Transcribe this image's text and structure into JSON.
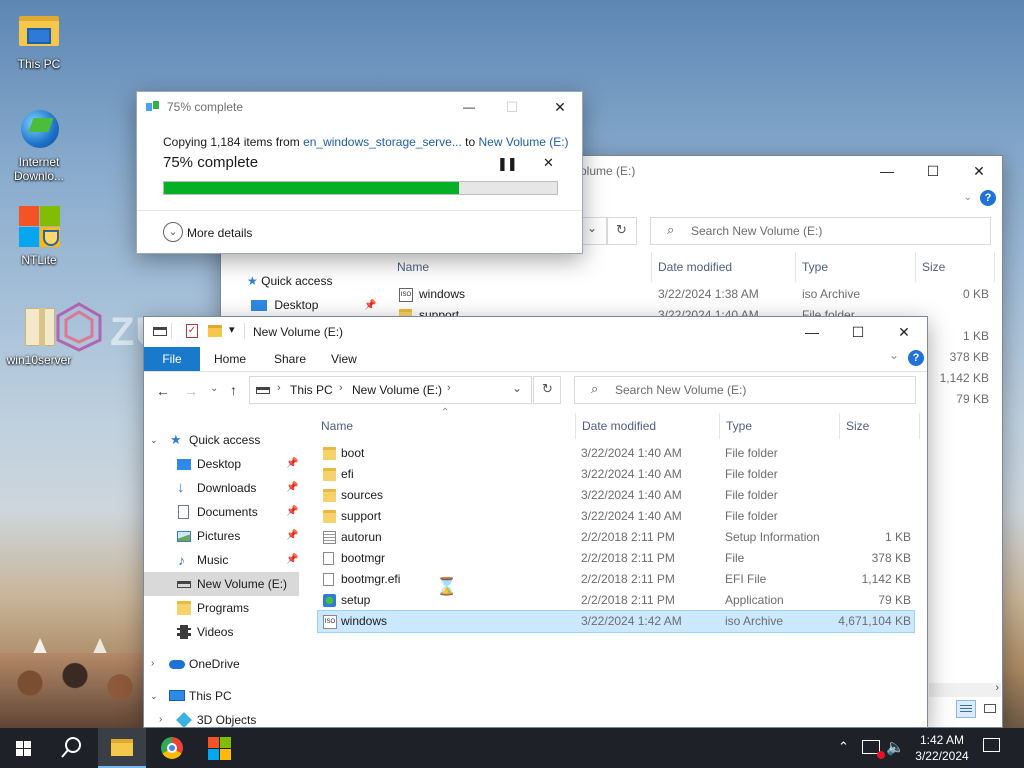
{
  "desktop": {
    "icons": [
      {
        "label": "This PC"
      },
      {
        "label": "Internet Downlo..."
      },
      {
        "label": "NTLite"
      },
      {
        "label": "win10server"
      }
    ],
    "watermark": "ZU"
  },
  "copy_dialog": {
    "title": "75% complete",
    "copying_prefix": "Copying 1,184 items from ",
    "source": "en_windows_storage_serve...",
    "to_text": " to ",
    "destination": "New Volume (E:)",
    "percent_text": "75% complete",
    "progress": 0.75,
    "pause_icon": "pause-icon",
    "cancel_icon": "close-icon",
    "more_details": "More details",
    "accent": "#06b025"
  },
  "back_explorer": {
    "title_fragment": "olume (E:)",
    "search_placeholder": "Search New Volume (E:)",
    "headers": {
      "name": "Name",
      "date": "Date modified",
      "type": "Type",
      "size": "Size"
    },
    "quick_access": "Quick access",
    "desktop": "Desktop",
    "rows": [
      {
        "name": "windows",
        "date": "3/22/2024 1:38 AM",
        "type": "iso Archive",
        "size": "0 KB"
      },
      {
        "name": "support",
        "date": "3/22/2024 1:40 AM",
        "type": "File folder",
        "size": ""
      }
    ],
    "sizes_visible": [
      "1 KB",
      "378 KB",
      "1,142 KB",
      "79 KB"
    ]
  },
  "explorer": {
    "title": "New Volume (E:)",
    "ribbon_tabs": [
      "File",
      "Home",
      "Share",
      "View"
    ],
    "breadcrumb": [
      "This PC",
      "New Volume (E:)"
    ],
    "search_placeholder": "Search New Volume (E:)",
    "headers": {
      "name": "Name",
      "date": "Date modified",
      "type": "Type",
      "size": "Size"
    },
    "nav": {
      "quick_access": "Quick access",
      "items": [
        "Desktop",
        "Downloads",
        "Documents",
        "Pictures",
        "Music",
        "New Volume (E:)",
        "Programs",
        "Videos"
      ],
      "onedrive": "OneDrive",
      "this_pc": "This PC",
      "objects3d": "3D Objects"
    },
    "files": [
      {
        "name": "boot",
        "date": "3/22/2024 1:40 AM",
        "type": "File folder",
        "size": "",
        "icon": "folder-icon"
      },
      {
        "name": "efi",
        "date": "3/22/2024 1:40 AM",
        "type": "File folder",
        "size": "",
        "icon": "folder-icon"
      },
      {
        "name": "sources",
        "date": "3/22/2024 1:40 AM",
        "type": "File folder",
        "size": "",
        "icon": "folder-icon"
      },
      {
        "name": "support",
        "date": "3/22/2024 1:40 AM",
        "type": "File folder",
        "size": "",
        "icon": "folder-icon"
      },
      {
        "name": "autorun",
        "date": "2/2/2018 2:11 PM",
        "type": "Setup Information",
        "size": "1 KB",
        "icon": "setup-info-icon"
      },
      {
        "name": "bootmgr",
        "date": "2/2/2018 2:11 PM",
        "type": "File",
        "size": "378 KB",
        "icon": "file-icon"
      },
      {
        "name": "bootmgr.efi",
        "date": "2/2/2018 2:11 PM",
        "type": "EFI File",
        "size": "1,142 KB",
        "icon": "file-icon"
      },
      {
        "name": "setup",
        "date": "2/2/2018 2:11 PM",
        "type": "Application",
        "size": "79 KB",
        "icon": "setup-app-icon"
      },
      {
        "name": "windows",
        "date": "3/22/2024 1:42 AM",
        "type": "iso Archive",
        "size": "4,671,104 KB",
        "icon": "iso-icon"
      }
    ],
    "selected_file": "windows"
  },
  "taskbar": {
    "time": "1:42 AM",
    "date": "3/22/2024",
    "dark": "#1e2228"
  }
}
